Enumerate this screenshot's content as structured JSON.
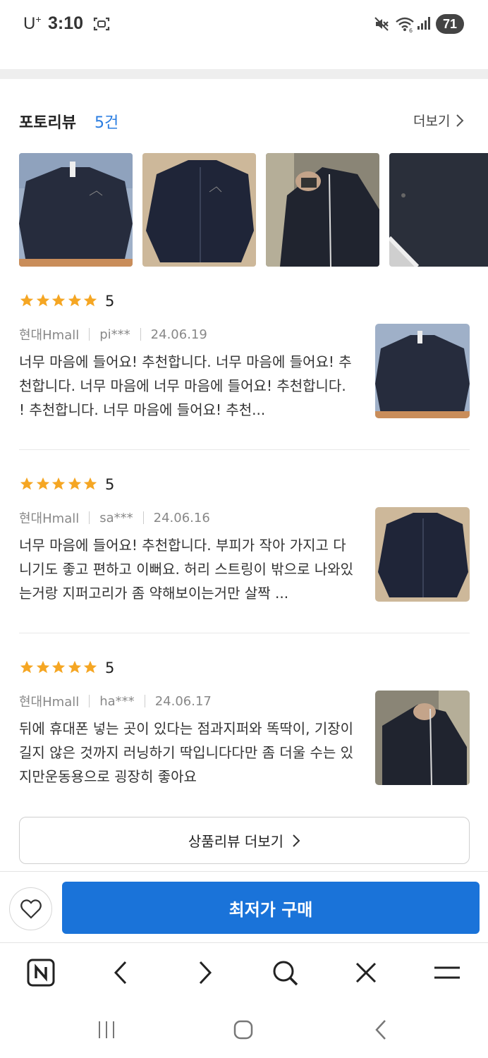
{
  "status_bar": {
    "carrier": "U",
    "carrier_sup": "+",
    "time": "3:10",
    "battery": "71"
  },
  "section": {
    "title": "포토리뷰",
    "count": "5건",
    "more_label": "더보기"
  },
  "reviews": [
    {
      "rating": "5",
      "mall": "현대Hmall",
      "user": "pi***",
      "date": "24.06.19",
      "text": "너무 마음에 들어요! 추천합니다. 너무 마음에 들어요! 추천합니다. 너무 마음에 너무 마음에 들어요! 추천합니다. ! 추천합니다. 너무 마음에 들어요! 추천..."
    },
    {
      "rating": "5",
      "mall": "현대Hmall",
      "user": "sa***",
      "date": "24.06.16",
      "text": "너무 마음에 들어요! 추천합니다. 부피가 작아 가지고 다니기도 좋고 편하고 이뻐요. 허리 스트링이 밖으로 나와있는거랑 지퍼고리가 좀 약해보이는거만 살짝 ..."
    },
    {
      "rating": "5",
      "mall": "현대Hmall",
      "user": "ha***",
      "date": "24.06.17",
      "text": "뒤에 휴대폰 넣는 곳이 있다는 점과지퍼와 똑딱이, 기장이 길지 않은 것까지 러닝하기 딱입니다다만 좀 더울 수는 있지만운동용으로 굉장히 좋아요"
    }
  ],
  "more_reviews_label": "상품리뷰 더보기",
  "buy_label": "최저가 구매",
  "colors": {
    "accent_blue": "#1a73d9",
    "count_blue": "#2a7de1",
    "star_orange": "#f5a623"
  },
  "icons": [
    "screenshot-icon",
    "mute-icon",
    "wifi-icon",
    "signal-icon",
    "chevron-right-icon",
    "star-icon",
    "heart-icon",
    "naver-n-icon",
    "back-arrow-icon",
    "forward-arrow-icon",
    "search-icon",
    "close-icon",
    "menu-icon",
    "recent-apps-icon",
    "home-icon",
    "android-back-icon"
  ]
}
